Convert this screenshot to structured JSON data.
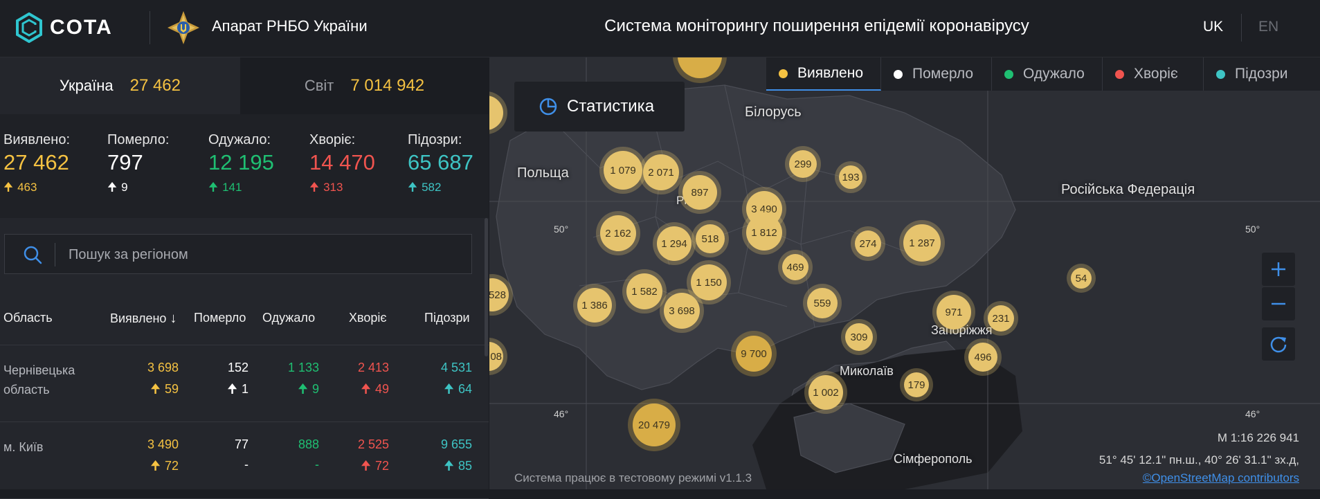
{
  "header": {
    "logo_text": "COTA",
    "org_name": "Апарат РНБО України",
    "system_title": "Система моніторингу поширення епідемії коронавірусу",
    "lang_uk": "UK",
    "lang_en": "EN"
  },
  "tabs": {
    "ukraine": {
      "label": "Україна",
      "value": "27 462"
    },
    "world": {
      "label": "Світ",
      "value": "7 014 942"
    }
  },
  "stats": [
    {
      "label": "Виявлено:",
      "value": "27 462",
      "delta": "463",
      "color": "#f5c242"
    },
    {
      "label": "Померло:",
      "value": "797",
      "delta": "9",
      "color": "#ffffff"
    },
    {
      "label": "Одужало:",
      "value": "12 195",
      "delta": "141",
      "color": "#1fbf72"
    },
    {
      "label": "Хворіє:",
      "value": "14 470",
      "delta": "313",
      "color": "#f0544f"
    },
    {
      "label": "Підозри:",
      "value": "65 687",
      "delta": "582",
      "color": "#3ec4c4"
    }
  ],
  "search": {
    "placeholder": "Пошук за регіоном"
  },
  "table": {
    "headers": [
      "Область",
      "Виявлено",
      "Померло",
      "Одужало",
      "Хворіє",
      "Підозри"
    ],
    "rows": [
      {
        "region": "Чернівецька область",
        "confirmed": "3 698",
        "confirmed_delta": "59",
        "deaths": "152",
        "deaths_delta": "1",
        "recovered": "1 133",
        "recovered_delta": "9",
        "sick": "2 413",
        "sick_delta": "49",
        "suspected": "4 531",
        "suspected_delta": "64"
      },
      {
        "region": "м. Київ",
        "confirmed": "3 490",
        "confirmed_delta": "72",
        "deaths": "77",
        "deaths_delta": "-",
        "recovered": "888",
        "recovered_delta": "-",
        "sick": "2 525",
        "sick_delta": "72",
        "suspected": "9 655",
        "suspected_delta": "85"
      }
    ]
  },
  "map": {
    "stat_button": "Статистика",
    "legend": [
      {
        "label": "Виявлено",
        "color": "#f5c242",
        "active": true
      },
      {
        "label": "Померло",
        "color": "#ffffff",
        "active": false
      },
      {
        "label": "Одужало",
        "color": "#1fbf72",
        "active": false
      },
      {
        "label": "Хворіє",
        "color": "#f0544f",
        "active": false
      },
      {
        "label": "Підозри",
        "color": "#3ec4c4",
        "active": false
      }
    ],
    "labels": {
      "belarus": "Білорусь",
      "poland": "Польща",
      "russia": "Російська Федерація",
      "rivne": "Рівне",
      "zaporizhzhia": "Запоріжжя",
      "mykolaiv": "Миколаїв",
      "simferopol": "Сімферополь",
      "lat50_left": "50°",
      "lat50_right": "50°",
      "lat46_left": "46°",
      "lat46_right": "46°"
    },
    "clusters": [
      "1 079",
      "2 071",
      "897",
      "299",
      "193",
      "3 490",
      "1 812",
      "2 162",
      "1 294",
      "518",
      "274",
      "1 287",
      "469",
      "54",
      "1 150",
      "1 386",
      "1 582",
      "3 698",
      "559",
      "971",
      "231",
      "528",
      "9 700",
      "309",
      "496",
      "1 002",
      "179",
      "20 479",
      "08"
    ],
    "scale": "М 1:16 226 941",
    "coords": "51° 45' 12.1\" пн.ш., 40° 26' 31.1\" зх.д,",
    "osm": "©OpenStreetMap contributors",
    "test_mode": "Система працює в тестовому режимі v1.1.3"
  }
}
